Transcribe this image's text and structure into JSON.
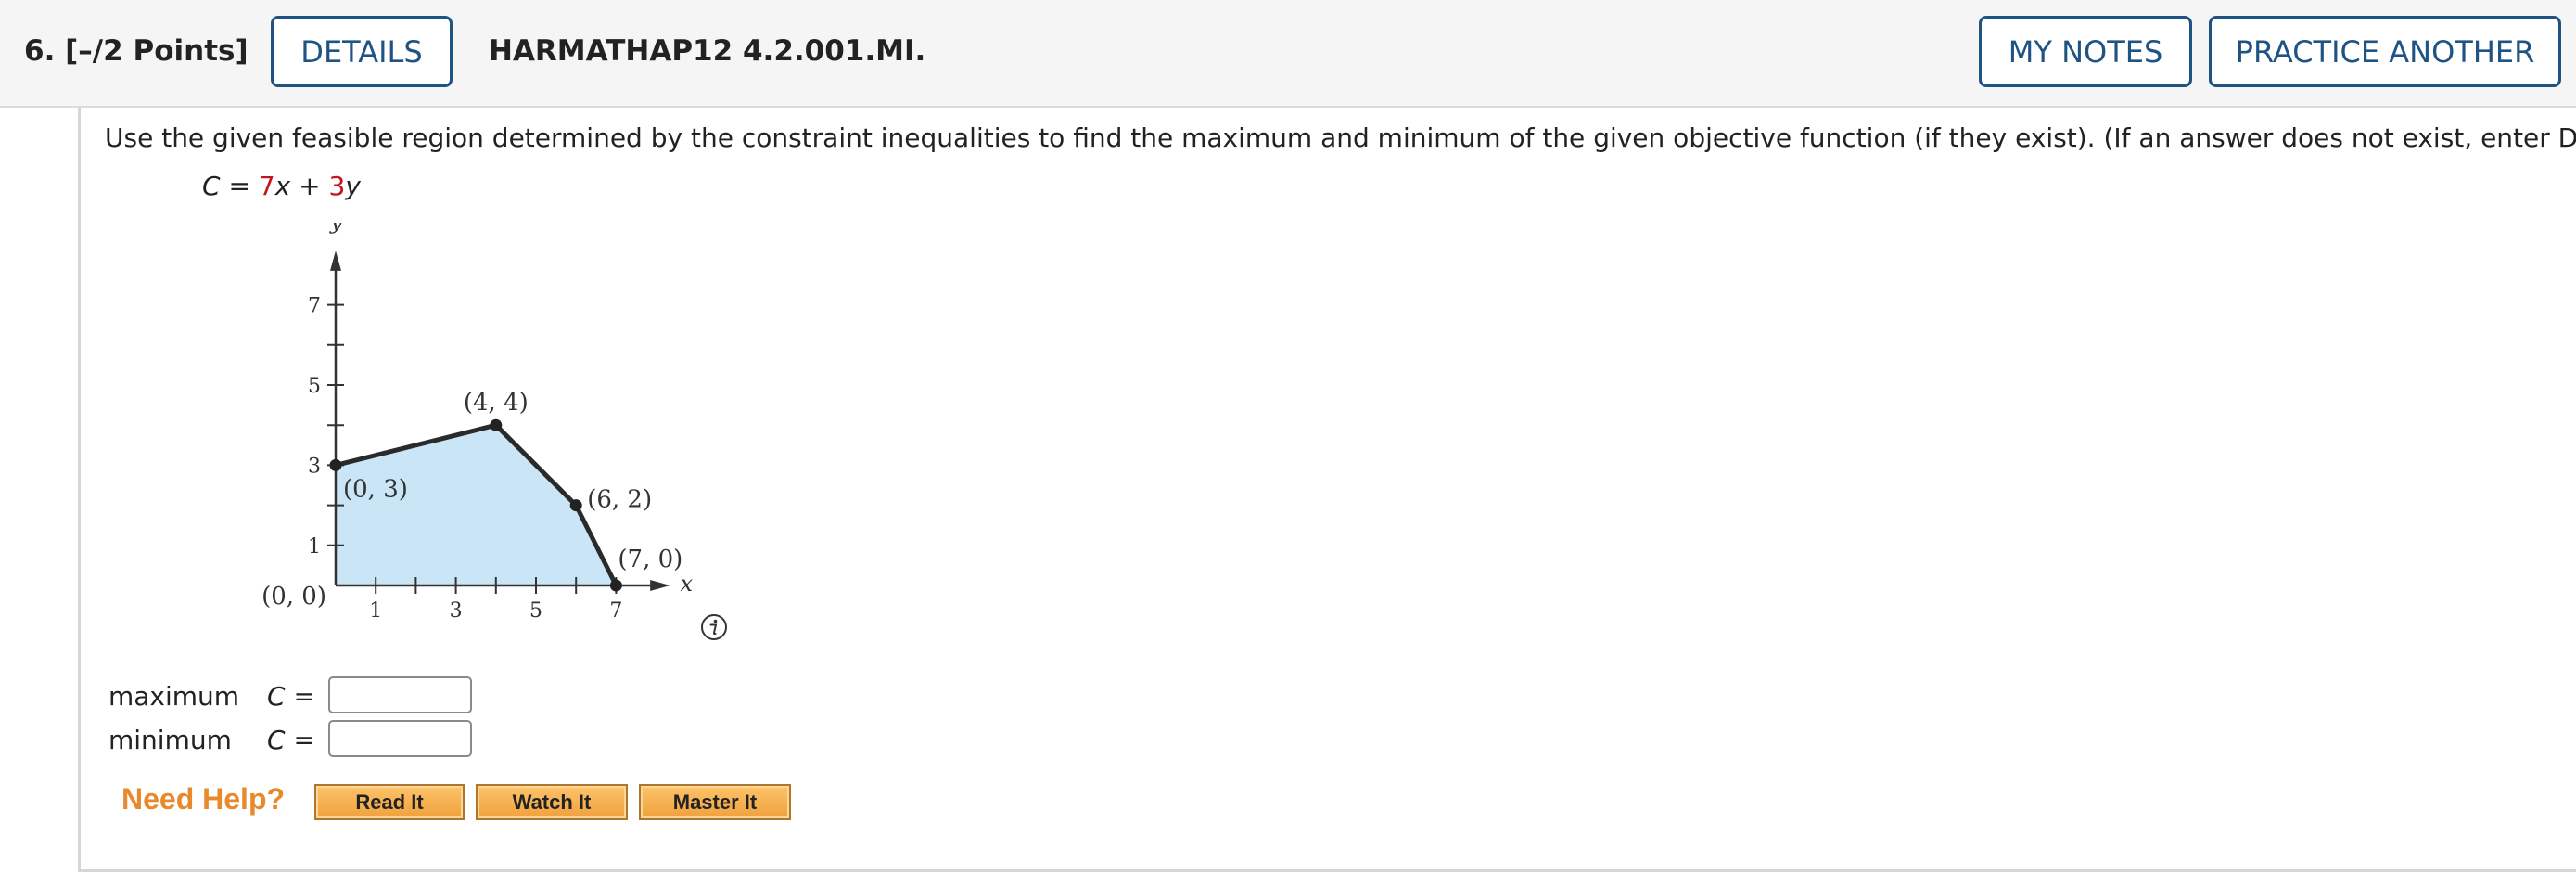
{
  "header": {
    "question_label": "6.  [–/2 Points]",
    "details_label": "DETAILS",
    "question_id": "HARMATHAP12 4.2.001.MI.",
    "my_notes_label": "MY NOTES",
    "practice_label": "PRACTICE ANOTHER"
  },
  "question": {
    "prompt": "Use the given feasible region determined by the constraint inequalities to find the maximum and minimum of the given objective function (if they exist). (If an answer does not exist, enter DNE.)",
    "objective": {
      "lhs": "C",
      "eq": " = ",
      "coef_x": "7",
      "var_x": "x",
      "plus": " + ",
      "coef_y": "3",
      "var_y": "y"
    },
    "colors": {
      "coef": "#c0161e",
      "region_fill": "#c9e5f6",
      "accent": "#1f5383",
      "help": "#e8892b"
    }
  },
  "graph": {
    "x_axis_label": "x",
    "y_axis_label": "y",
    "x_ticks_labeled": [
      "1",
      "3",
      "5",
      "7"
    ],
    "y_ticks_labeled": [
      "1",
      "3",
      "5",
      "7"
    ],
    "vertices": [
      {
        "x": 0,
        "y": 0,
        "label": "(0, 0)"
      },
      {
        "x": 0,
        "y": 3,
        "label": "(0, 3)"
      },
      {
        "x": 4,
        "y": 4,
        "label": "(4, 4)"
      },
      {
        "x": 6,
        "y": 2,
        "label": "(6, 2)"
      },
      {
        "x": 7,
        "y": 0,
        "label": "(7, 0)"
      }
    ],
    "info_icon": "info-icon"
  },
  "answers": {
    "maximum": {
      "label": "maximum",
      "lhs": "C",
      "eq": " = ",
      "value": ""
    },
    "minimum": {
      "label": "minimum",
      "lhs": "C",
      "eq": " = ",
      "value": ""
    }
  },
  "help": {
    "label": "Need Help?",
    "buttons": [
      "Read It",
      "Watch It",
      "Master It"
    ]
  }
}
